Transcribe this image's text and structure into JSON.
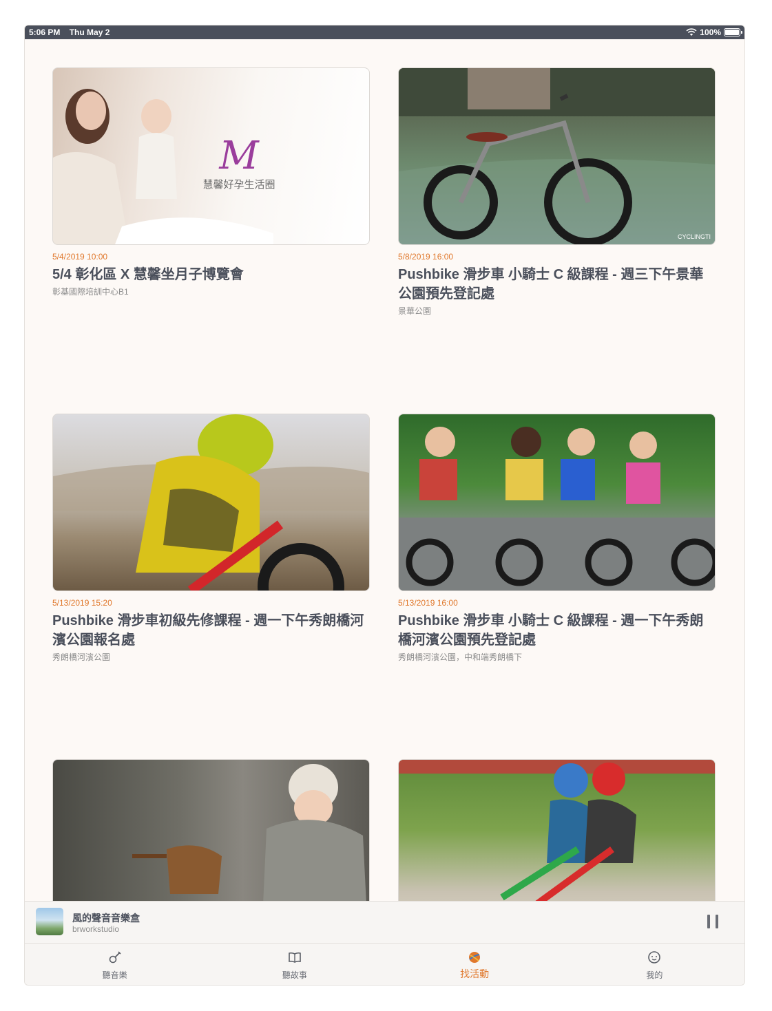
{
  "status_bar": {
    "time": "5:06 PM",
    "date": "Thu May 2",
    "battery": "100%"
  },
  "events": [
    {
      "date": "5/4/2019 10:00",
      "title": "5/4 彰化區 X 慧馨坐月子博覽會",
      "place": "彰基國際培訓中心B1",
      "logo_text": "慧馨好孕生活圈"
    },
    {
      "date": "5/8/2019 16:00",
      "title": "Pushbike 滑步車 小騎士 C 級課程 - 週三下午景華公園預先登記處",
      "place": "景華公園",
      "watermark": "CYCLINGTI"
    },
    {
      "date": "5/13/2019 15:20",
      "title": "Pushbike 滑步車初級先修課程 - 週一下午秀朗橋河濱公園報名處",
      "place": "秀朗橋河濱公園"
    },
    {
      "date": "5/13/2019 16:00",
      "title": "Pushbike 滑步車 小騎士 C 級課程 - 週一下午秀朗橋河濱公園預先登記處",
      "place": "秀朗橋河濱公園，中和端秀朗橋下"
    }
  ],
  "now_playing": {
    "title": "風的聲音音樂盒",
    "artist": "brworkstudio"
  },
  "tabs": [
    {
      "label": "聽音樂",
      "icon": "guitar-icon"
    },
    {
      "label": "聽故事",
      "icon": "book-icon"
    },
    {
      "label": "找活動",
      "icon": "ball-icon",
      "active": true
    },
    {
      "label": "我的",
      "icon": "smiley-icon"
    }
  ],
  "colors": {
    "accent": "#e0782c",
    "title": "#4a4f5b",
    "background": "#fdf9f6",
    "status_bar": "#4a4f5b"
  }
}
